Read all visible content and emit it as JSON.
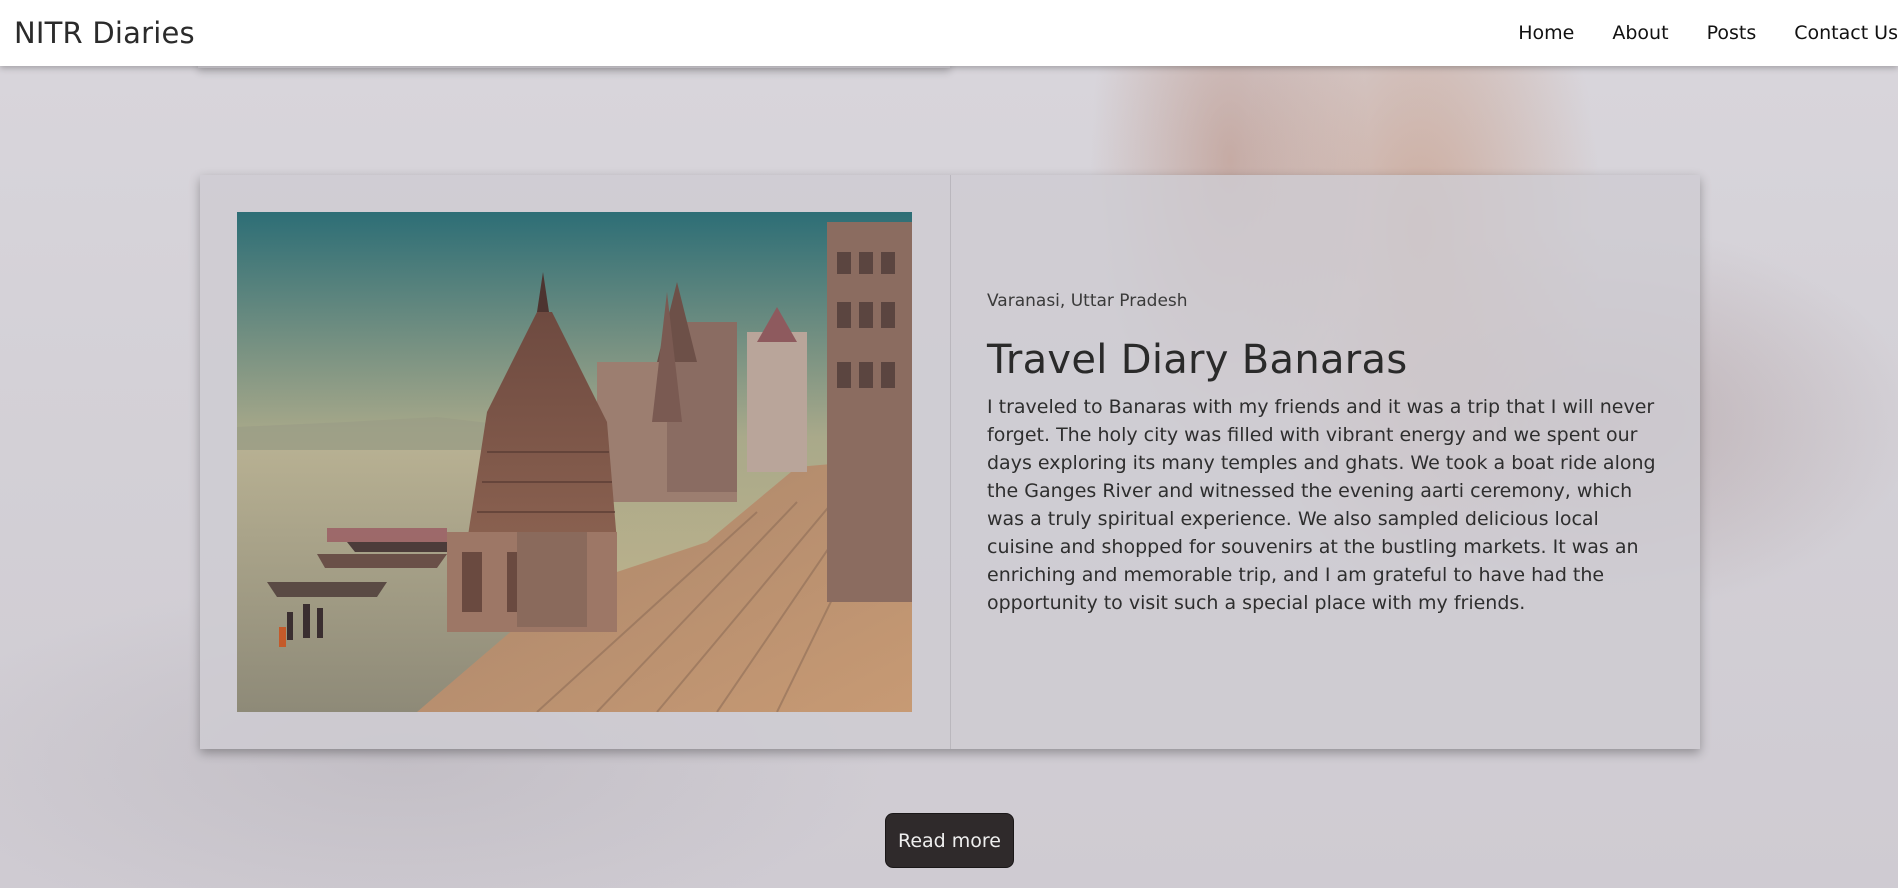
{
  "navbar": {
    "brand": "NITR Diaries",
    "links": [
      "Home",
      "About",
      "Posts",
      "Contact Us"
    ]
  },
  "post": {
    "location": "Varanasi, Uttar Pradesh",
    "title": "Travel Diary Banaras",
    "body": "I traveled to Banaras with my friends and it was a trip that I will never forget. The holy city was filled with vibrant energy and we spent our days exploring its many temples and ghats. We took a boat ride along the Ganges River and witnessed the evening aarti ceremony, which was a truly spiritual experience. We also sampled delicious local cuisine and shopped for souvenirs at the bustling markets. It was an enriching and memorable trip, and I am grateful to have had the opportunity to visit such a special place with my friends.",
    "image": "varanasi-ghat-photo"
  },
  "actions": {
    "read_more": "Read more"
  }
}
